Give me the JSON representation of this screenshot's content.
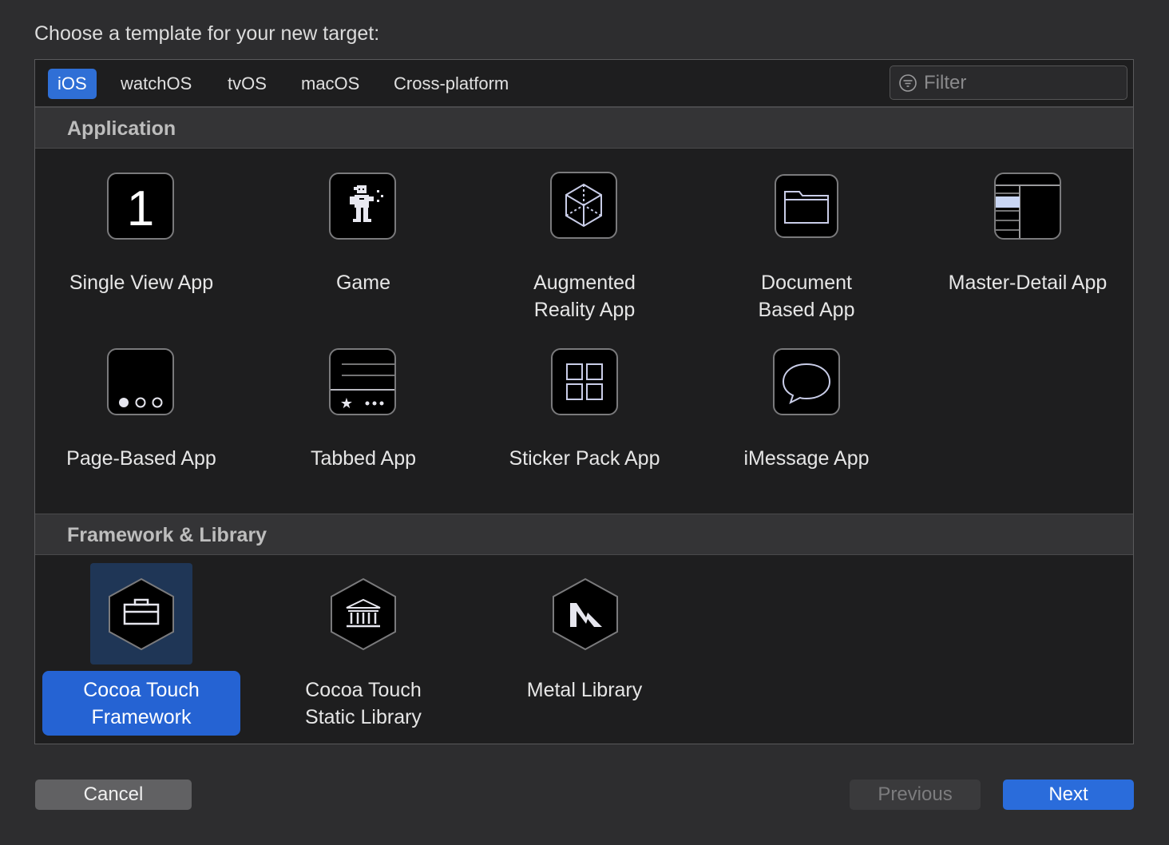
{
  "prompt": "Choose a template for your new target:",
  "tabs": [
    {
      "label": "iOS",
      "active": true
    },
    {
      "label": "watchOS"
    },
    {
      "label": "tvOS"
    },
    {
      "label": "macOS"
    },
    {
      "label": "Cross-platform"
    }
  ],
  "filter": {
    "placeholder": "Filter"
  },
  "sections": {
    "application": {
      "title": "Application",
      "items": [
        {
          "line1": "Single View App",
          "line2": "",
          "icon": "single-view-icon"
        },
        {
          "line1": "Game",
          "line2": "",
          "icon": "game-icon"
        },
        {
          "line1": "Augmented",
          "line2": "Reality App",
          "icon": "ar-cube-icon"
        },
        {
          "line1": "Document",
          "line2": "Based App",
          "icon": "folder-icon"
        },
        {
          "line1": "Master-Detail App",
          "line2": "",
          "icon": "master-detail-icon"
        },
        {
          "line1": "Page-Based App",
          "line2": "",
          "icon": "page-dots-icon"
        },
        {
          "line1": "Tabbed App",
          "line2": "",
          "icon": "tabbed-icon"
        },
        {
          "line1": "Sticker Pack App",
          "line2": "",
          "icon": "grid-icon"
        },
        {
          "line1": "iMessage App",
          "line2": "",
          "icon": "speech-bubble-icon"
        }
      ]
    },
    "framework": {
      "title": "Framework & Library",
      "items": [
        {
          "line1": "Cocoa Touch",
          "line2": "Framework",
          "icon": "toolbox-icon",
          "selected": true
        },
        {
          "line1": "Cocoa Touch",
          "line2": "Static Library",
          "icon": "library-building-icon"
        },
        {
          "line1": "Metal Library",
          "line2": "",
          "icon": "metal-icon"
        }
      ]
    }
  },
  "buttons": {
    "cancel": "Cancel",
    "previous": "Previous",
    "next": "Next"
  }
}
